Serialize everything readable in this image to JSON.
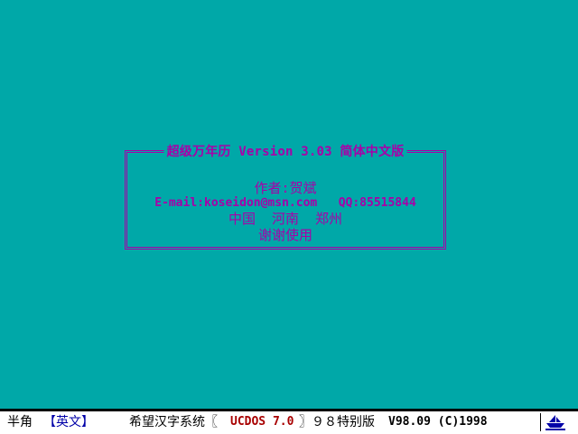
{
  "dialog": {
    "title": "超级万年历 Version 3.03  简体中文版",
    "author": "作者:贺斌",
    "contact": "E-mail:koseidon@msn.com   QQ:85515844",
    "location": "中国  河南  郑州",
    "thanks": "谢谢使用"
  },
  "status_bar": {
    "width_mode": "半角",
    "input_mode": "【英文】",
    "system_name": "希望汉字系统〖",
    "product": "UCDOS 7.0",
    "edition_label": "〗９８特别版",
    "version": "V98.09 (C)1998",
    "icon": "ship-icon"
  },
  "colors": {
    "background": "#00a8a8",
    "text": "#a800a8",
    "status_background": "#ffffff",
    "input_mode": "#0000a8",
    "product": "#a80000"
  }
}
